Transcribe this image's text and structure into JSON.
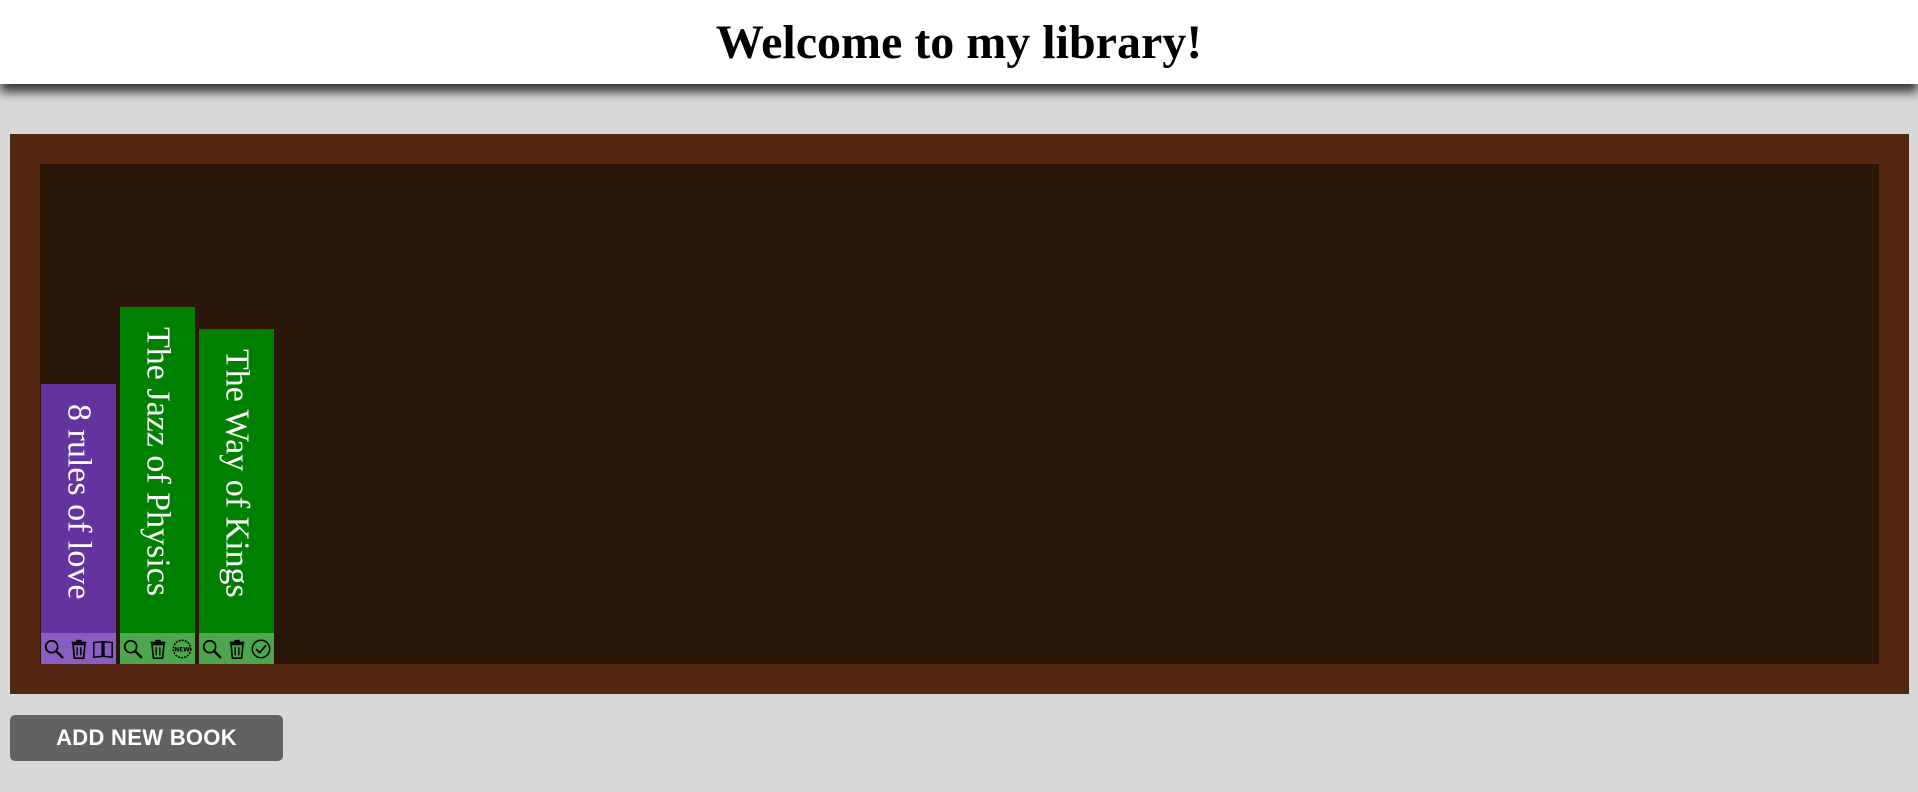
{
  "header": {
    "title": "Welcome to my library!"
  },
  "colors": {
    "header_bg": "#ffffff",
    "page_bg": "#d9d8d9",
    "shelf_frame": "#552712",
    "shelf_inner": "#2b160a",
    "button_bg": "#606263",
    "button_text": "#ffffff"
  },
  "books": [
    {
      "title": "8 rules of love",
      "spine_color": "#6334a0",
      "action_bar_color": "#8a5dc0",
      "spine_height": 280,
      "actions": [
        "search-icon",
        "trash-icon",
        "open-book-icon"
      ]
    },
    {
      "title": "The Jazz of Physics",
      "spine_color": "#008000",
      "action_bar_color": "#4ca64c",
      "spine_height": 357,
      "actions": [
        "search-icon",
        "trash-icon",
        "new-badge-icon"
      ]
    },
    {
      "title": "The Way of Kings",
      "spine_color": "#008000",
      "action_bar_color": "#4ca64c",
      "spine_height": 335,
      "actions": [
        "search-icon",
        "trash-icon",
        "check-circle-icon"
      ]
    }
  ],
  "badges": {
    "new_label": "NEW"
  },
  "footer": {
    "add_button_label": "ADD NEW BOOK"
  }
}
